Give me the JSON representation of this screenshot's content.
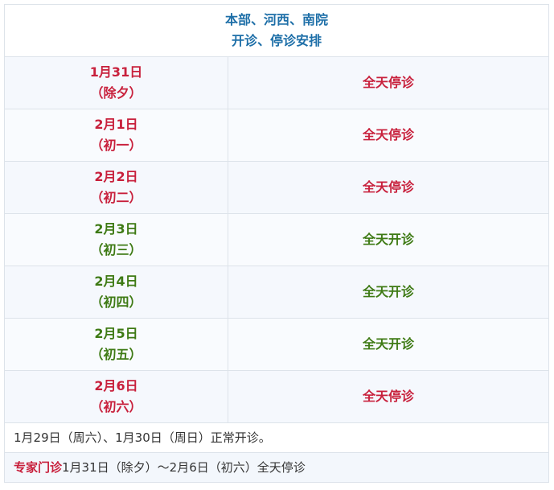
{
  "header": {
    "line1": "本部、河西、南院",
    "line2": "开诊、停诊安排"
  },
  "rows": [
    {
      "date": "1月31日",
      "day": "（除夕）",
      "status": "全天停诊",
      "kind": "closed"
    },
    {
      "date": "2月1日",
      "day": "（初一）",
      "status": "全天停诊",
      "kind": "closed"
    },
    {
      "date": "2月2日",
      "day": "（初二）",
      "status": "全天停诊",
      "kind": "closed"
    },
    {
      "date": "2月3日",
      "day": "（初三）",
      "status": "全天开诊",
      "kind": "open"
    },
    {
      "date": "2月4日",
      "day": "（初四）",
      "status": "全天开诊",
      "kind": "open"
    },
    {
      "date": "2月5日",
      "day": "（初五）",
      "status": "全天开诊",
      "kind": "open"
    },
    {
      "date": "2月6日",
      "day": "（初六）",
      "status": "全天停诊",
      "kind": "closed"
    }
  ],
  "notes": {
    "normal": "1月29日（周六）、1月30日（周日）正常开诊。",
    "expert_label": "专家门诊",
    "expert_text": "1月31日（除夕）～2月6日（初六）全天停诊"
  },
  "colors": {
    "header_blue": "#1e6fa8",
    "closed_red": "#c8203c",
    "open_green": "#3e7a14"
  }
}
